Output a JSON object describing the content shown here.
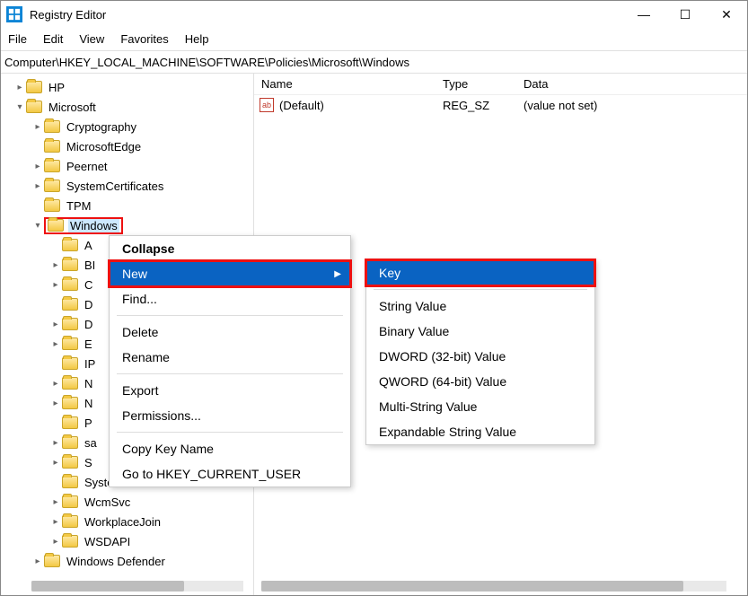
{
  "window": {
    "title": "Registry Editor"
  },
  "menubar": [
    "File",
    "Edit",
    "View",
    "Favorites",
    "Help"
  ],
  "address": "Computer\\HKEY_LOCAL_MACHINE\\SOFTWARE\\Policies\\Microsoft\\Windows",
  "tree": {
    "rows": [
      {
        "indent": 14,
        "chev": "right",
        "label": "HP"
      },
      {
        "indent": 14,
        "chev": "down",
        "label": "Microsoft"
      },
      {
        "indent": 34,
        "chev": "right",
        "label": "Cryptography"
      },
      {
        "indent": 34,
        "chev": "",
        "label": "MicrosoftEdge"
      },
      {
        "indent": 34,
        "chev": "right",
        "label": "Peernet"
      },
      {
        "indent": 34,
        "chev": "right",
        "label": "SystemCertificates"
      },
      {
        "indent": 34,
        "chev": "",
        "label": "TPM"
      },
      {
        "indent": 34,
        "chev": "down",
        "label": "Windows",
        "selected": true,
        "redbox": true
      },
      {
        "indent": 54,
        "chev": "",
        "label": "A"
      },
      {
        "indent": 54,
        "chev": "right",
        "label": "BI"
      },
      {
        "indent": 54,
        "chev": "right",
        "label": "C"
      },
      {
        "indent": 54,
        "chev": "",
        "label": "D"
      },
      {
        "indent": 54,
        "chev": "right",
        "label": "D"
      },
      {
        "indent": 54,
        "chev": "right",
        "label": "E"
      },
      {
        "indent": 54,
        "chev": "",
        "label": "IP"
      },
      {
        "indent": 54,
        "chev": "right",
        "label": "N"
      },
      {
        "indent": 54,
        "chev": "right",
        "label": "N"
      },
      {
        "indent": 54,
        "chev": "",
        "label": "P"
      },
      {
        "indent": 54,
        "chev": "right",
        "label": "sa"
      },
      {
        "indent": 54,
        "chev": "right",
        "label": "S"
      },
      {
        "indent": 54,
        "chev": "",
        "label": "System"
      },
      {
        "indent": 54,
        "chev": "right",
        "label": "WcmSvc"
      },
      {
        "indent": 54,
        "chev": "right",
        "label": "WorkplaceJoin"
      },
      {
        "indent": 54,
        "chev": "right",
        "label": "WSDAPI"
      },
      {
        "indent": 34,
        "chev": "right",
        "label": "Windows Defender"
      }
    ]
  },
  "list": {
    "headers": {
      "name": "Name",
      "type": "Type",
      "data": "Data"
    },
    "rows": [
      {
        "name": "(Default)",
        "type": "REG_SZ",
        "data": "(value not set)"
      }
    ]
  },
  "ctx1": {
    "items": [
      {
        "label": "Collapse",
        "bold": true
      },
      {
        "label": "New",
        "hl": true,
        "arrow": true,
        "redbox": true
      },
      {
        "label": "Find..."
      },
      {
        "sep": true
      },
      {
        "label": "Delete"
      },
      {
        "label": "Rename"
      },
      {
        "sep": true
      },
      {
        "label": "Export"
      },
      {
        "label": "Permissions..."
      },
      {
        "sep": true
      },
      {
        "label": "Copy Key Name"
      },
      {
        "label": "Go to HKEY_CURRENT_USER"
      }
    ]
  },
  "ctx2": {
    "items": [
      {
        "label": "Key",
        "hl": true,
        "redbox": true
      },
      {
        "sep": true
      },
      {
        "label": "String Value"
      },
      {
        "label": "Binary Value"
      },
      {
        "label": "DWORD (32-bit) Value"
      },
      {
        "label": "QWORD (64-bit) Value"
      },
      {
        "label": "Multi-String Value"
      },
      {
        "label": "Expandable String Value"
      }
    ]
  }
}
